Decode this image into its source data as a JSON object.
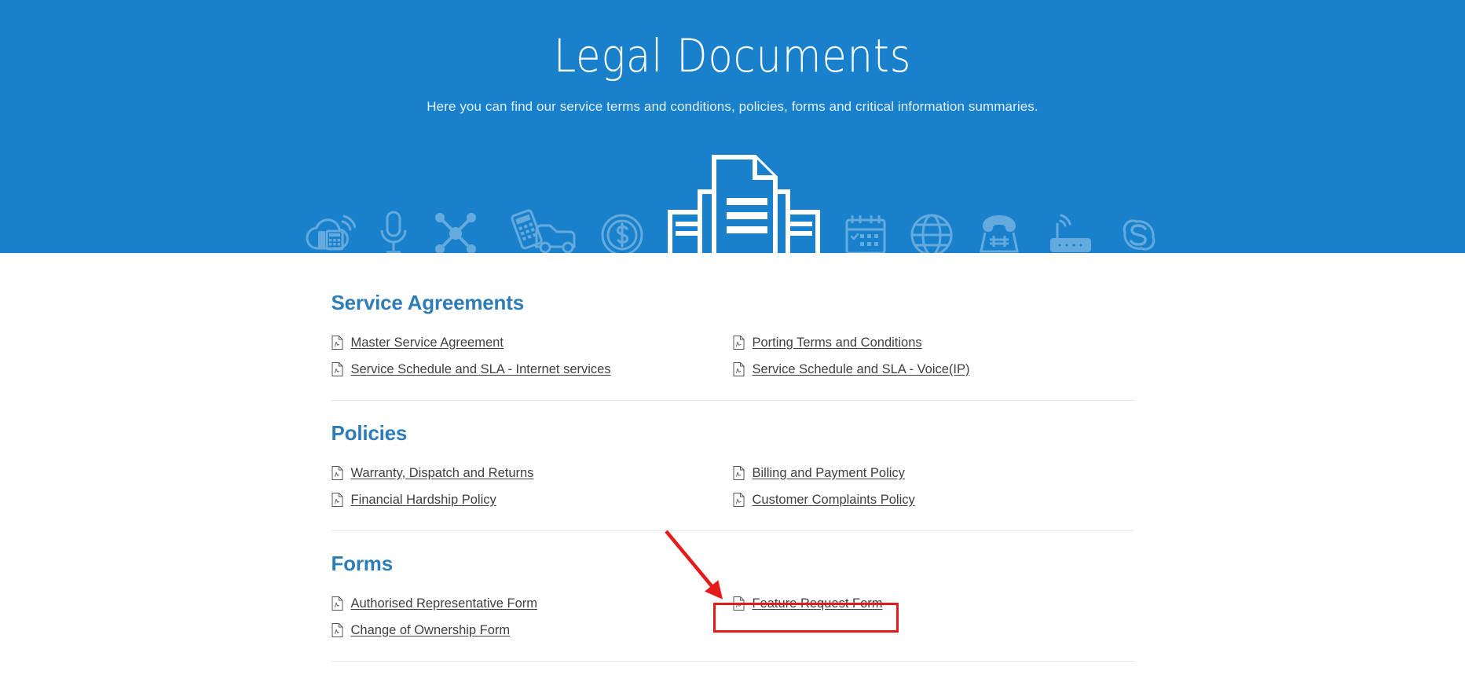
{
  "hero": {
    "title": "Legal Documents",
    "subtitle": "Here you can find our service terms and conditions, policies, forms and critical information summaries.",
    "background_color": "#1980cb",
    "icons": [
      "cloud-phone-icon",
      "microphone-icon",
      "network-nodes-icon",
      "mobile-car-icon",
      "dollar-coin-icon",
      "document-stack-icon",
      "calendar-icon",
      "globe-icon",
      "desk-phone-hash-icon",
      "wifi-router-icon",
      "skype-icon"
    ]
  },
  "theme": {
    "heading_color": "#2e7cb8",
    "link_color": "#3f3f3f",
    "annotation_color": "#e51b1b",
    "divider_color": "#e8e8e8"
  },
  "sections": [
    {
      "title": "Service Agreements",
      "left_links": [
        "Master Service Agreement",
        "Service Schedule and SLA - Internet services"
      ],
      "right_links": [
        "Porting Terms and Conditions",
        "Service Schedule and SLA - Voice(IP)"
      ]
    },
    {
      "title": "Policies",
      "left_links": [
        "Warranty, Dispatch and Returns",
        "Financial Hardship Policy"
      ],
      "right_links": [
        "Billing and Payment Policy",
        "Customer Complaints Policy"
      ]
    },
    {
      "title": "Forms",
      "left_links": [
        "Authorised Representative Form",
        "Change of Ownership Form"
      ],
      "right_links": [
        "Feature Request Form"
      ]
    }
  ],
  "annotation": {
    "highlighted_link": "Feature Request Form",
    "arrow": "red-arrow-pointing-down-right"
  }
}
